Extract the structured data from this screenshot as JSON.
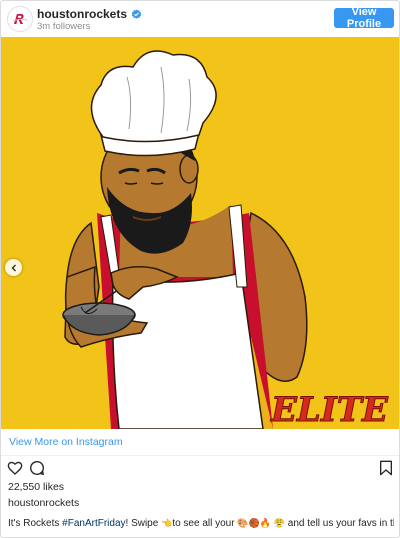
{
  "header": {
    "username": "houstonrockets",
    "followers": "3m followers",
    "view_profile_label": "View Profile",
    "verified_icon": "verified-badge-icon",
    "avatar_icon": "rockets-logo-icon"
  },
  "image": {
    "artwork_text": "ELITE",
    "description_icon": "chef-artwork",
    "carousel_icon": "chevron-left-icon"
  },
  "link": {
    "view_more_label": "View More on Instagram"
  },
  "actions": {
    "like_icon": "heart-icon",
    "comment_icon": "comment-icon",
    "save_icon": "bookmark-icon"
  },
  "post": {
    "likes": "22,550 likes",
    "username": "houstonrockets",
    "caption_prefix": "It's Rockets ",
    "caption_hashtag": "#FanArtFriday",
    "caption_mid": "! Swipe ",
    "caption_emoji_1": "👈",
    "caption_mid2": "to see all your ",
    "caption_emoji_2": "🎨🏀🔥",
    "caption_emoji_3": "😤",
    "caption_suffix": " and tell us your favs in the comments ",
    "caption_emoji_4": "👇"
  },
  "colors": {
    "accent_blue": "#3897f0",
    "artwork_yellow": "#f2c419",
    "skin": "#b5792f",
    "elite_red": "#d62b1c"
  }
}
